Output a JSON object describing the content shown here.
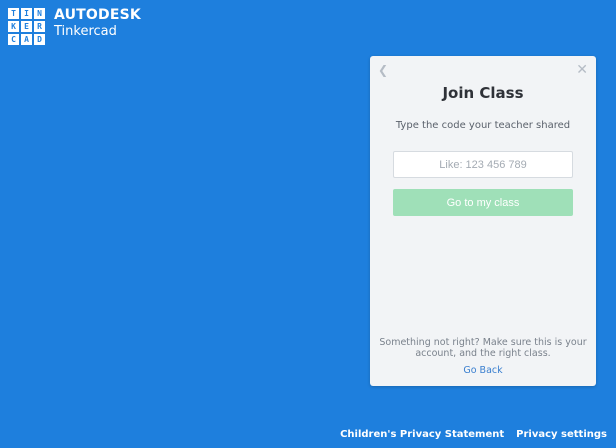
{
  "colors": {
    "background": "#1e7fdd",
    "card": "#f2f4f6",
    "button": "#9fe0b8",
    "link": "#3a7fcf"
  },
  "logo": {
    "letters": [
      "T",
      "I",
      "N",
      "K",
      "E",
      "R",
      "C",
      "A",
      "D"
    ],
    "brand": "AUTODESK",
    "product": "Tinkercad"
  },
  "dialog": {
    "back_icon": "chevron-left-icon",
    "close_icon": "close-icon",
    "title": "Join Class",
    "description": "Type the code your teacher shared",
    "code_input": {
      "placeholder": "Like: 123 456 789",
      "value": ""
    },
    "submit_label": "Go to my class",
    "help_text": "Something not right? Make sure this is your account, and the right class.",
    "go_back_label": "Go Back"
  },
  "footer": {
    "privacy_statement": "Children's Privacy Statement",
    "privacy_settings": "Privacy settings"
  }
}
